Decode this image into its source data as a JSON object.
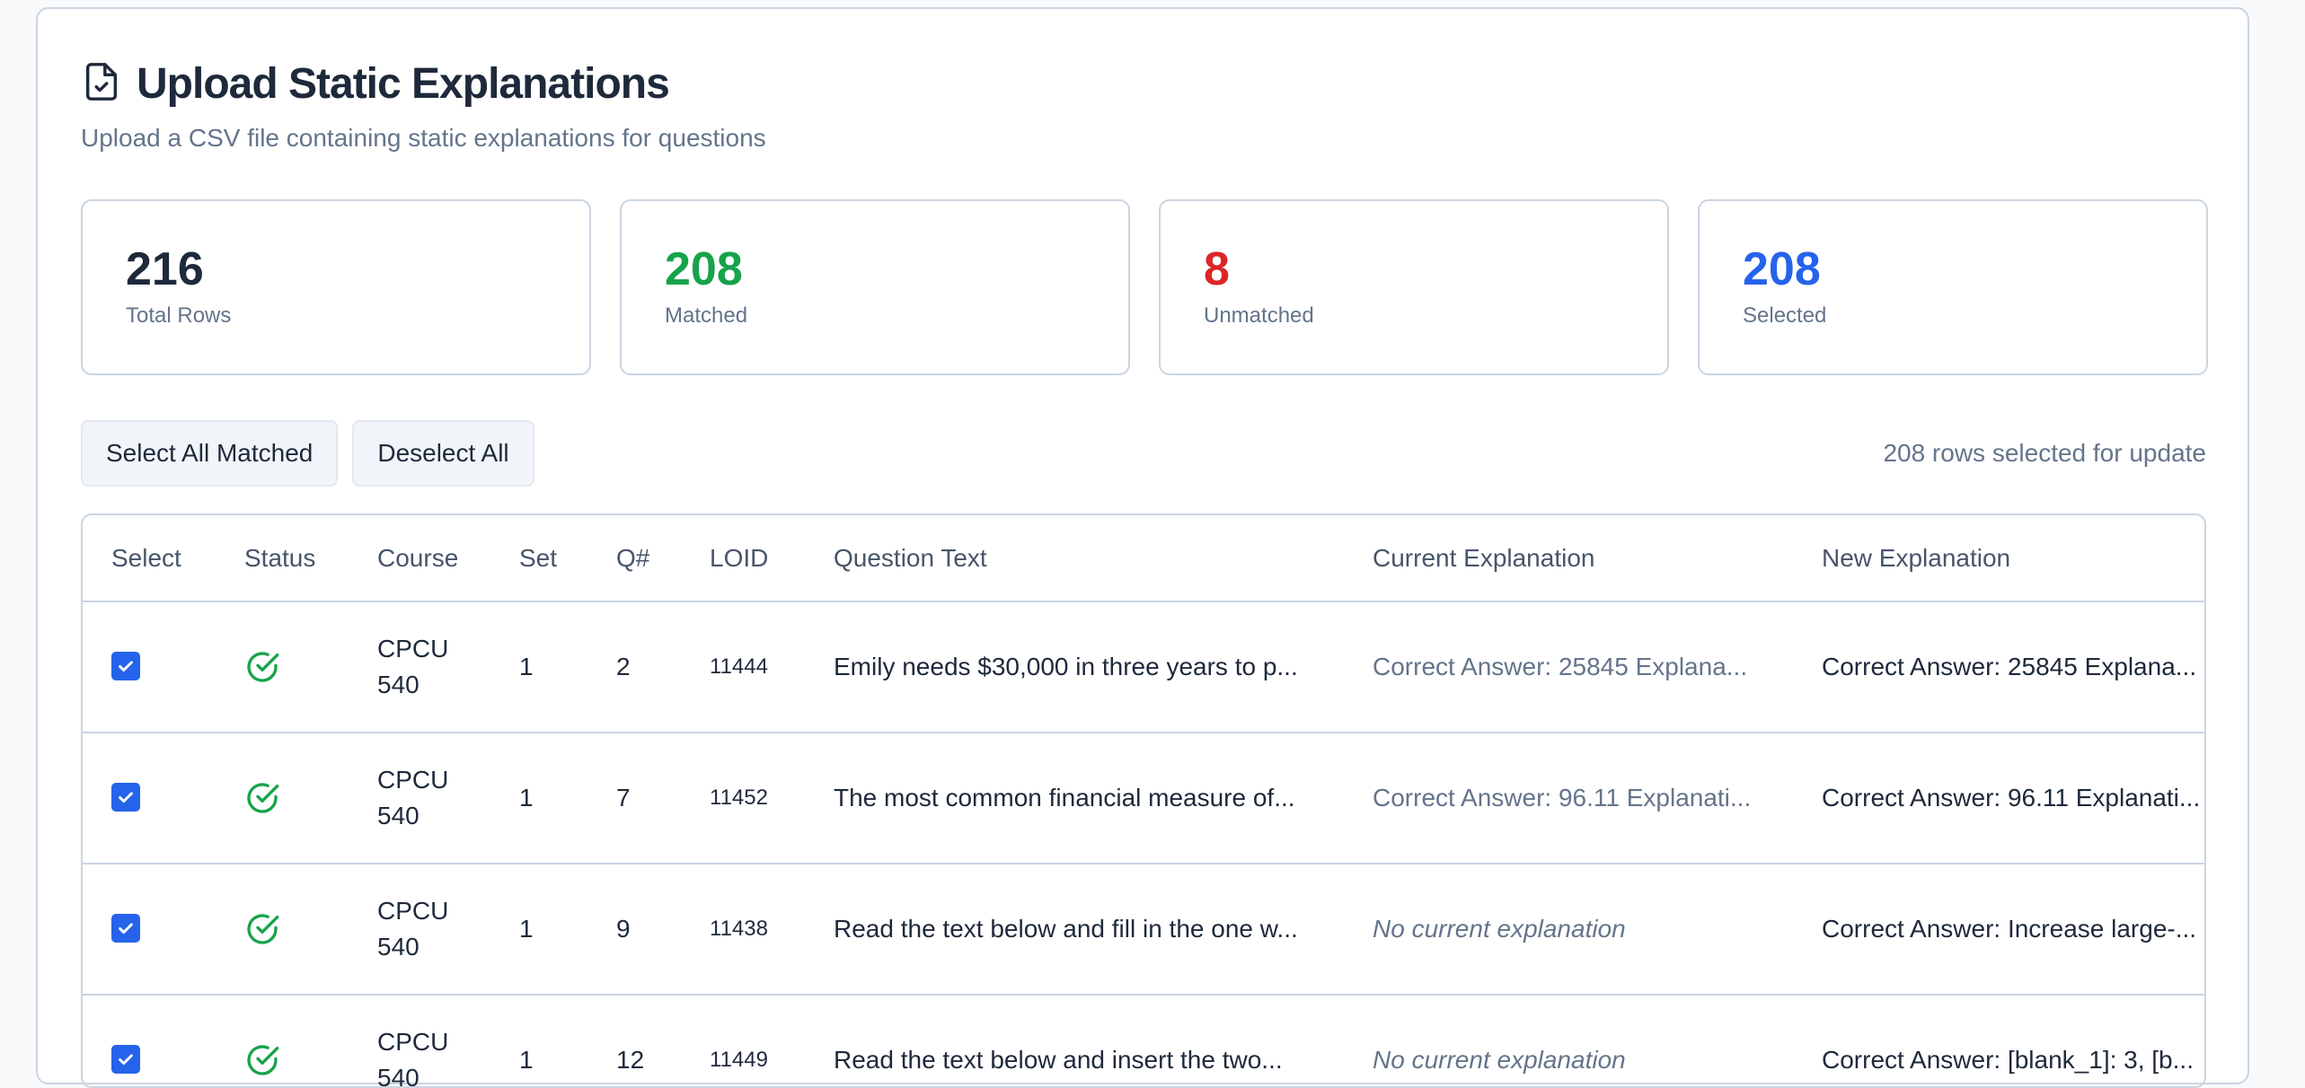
{
  "header": {
    "title": "Upload Static Explanations",
    "subtitle": "Upload a CSV file containing static explanations for questions"
  },
  "stats": [
    {
      "value": "216",
      "label": "Total Rows",
      "color": "#1e293b"
    },
    {
      "value": "208",
      "label": "Matched",
      "color": "#16a34a"
    },
    {
      "value": "8",
      "label": "Unmatched",
      "color": "#dc2626"
    },
    {
      "value": "208",
      "label": "Selected",
      "color": "#2563eb"
    }
  ],
  "toolbar": {
    "select_all_label": "Select All Matched",
    "deselect_all_label": "Deselect All",
    "selection_summary": "208 rows selected for update"
  },
  "table": {
    "columns": [
      "Select",
      "Status",
      "Course",
      "Set",
      "Q#",
      "LOID",
      "Question Text",
      "Current Explanation",
      "New Explanation"
    ],
    "rows": [
      {
        "selected": true,
        "status": "matched",
        "course": "CPCU 540",
        "set": "1",
        "q": "2",
        "loid": "11444",
        "question": "Emily needs $30,000 in three years to p...",
        "current": "Correct Answer: 25845 Explana...",
        "current_empty": false,
        "new": "Correct Answer: 25845 Explana..."
      },
      {
        "selected": true,
        "status": "matched",
        "course": "CPCU 540",
        "set": "1",
        "q": "7",
        "loid": "11452",
        "question": "The most common financial measure of...",
        "current": "Correct Answer: 96.11 Explanati...",
        "current_empty": false,
        "new": "Correct Answer: 96.11 Explanati..."
      },
      {
        "selected": true,
        "status": "matched",
        "course": "CPCU 540",
        "set": "1",
        "q": "9",
        "loid": "11438",
        "question": "Read the text below and fill in the one w...",
        "current": "No current explanation",
        "current_empty": true,
        "new": "Correct Answer: Increase large-..."
      },
      {
        "selected": true,
        "status": "matched",
        "course": "CPCU 540",
        "set": "1",
        "q": "12",
        "loid": "11449",
        "question": "Read the text below and insert the two...",
        "current": "No current explanation",
        "current_empty": true,
        "new": "Correct Answer: [blank_1]: 3, [b..."
      }
    ]
  }
}
